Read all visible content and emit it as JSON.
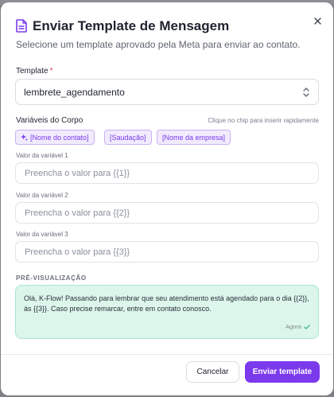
{
  "modal": {
    "title": "Enviar Template de Mensagem",
    "subtitle": "Selecione um template aprovado pela Meta para enviar ao contato."
  },
  "template": {
    "label": "Template",
    "required_mark": "*",
    "value": "lembrete_agendamento"
  },
  "variables": {
    "label": "Variáveis do Corpo",
    "hint": "Clique no chip para inserir rapidamente",
    "chips": [
      "[Nome do contato]",
      "[Saudação]",
      "[Nome da empresa]"
    ],
    "fields": [
      {
        "label": "Valor da variável 1",
        "placeholder": "Preencha o valor para {{1}}",
        "value": ""
      },
      {
        "label": "Valor da variável 2",
        "placeholder": "Preencha o valor para {{2}}",
        "value": ""
      },
      {
        "label": "Valor da variável 3",
        "placeholder": "Preencha o valor para {{3}}",
        "value": ""
      }
    ]
  },
  "preview": {
    "label": "PRÉ-VISUALIZAÇÃO",
    "text": "Olá, K-Flow! Passando para lembrar que seu atendimento está agendado para o dia {{2}}, às {{3}}. Caso precise remarcar, entre em contato conosco.",
    "time": "Agora"
  },
  "footer": {
    "cancel_label": "Cancelar",
    "send_label": "Enviar template"
  },
  "colors": {
    "accent": "#7c3aed",
    "preview_bg": "#dcf6ec",
    "required": "#e0394c"
  },
  "icons": {
    "header": "document-icon",
    "close": "close-icon",
    "select": "chevron-up-down-icon",
    "chip": "sparkle-icon",
    "status": "check-icon"
  }
}
